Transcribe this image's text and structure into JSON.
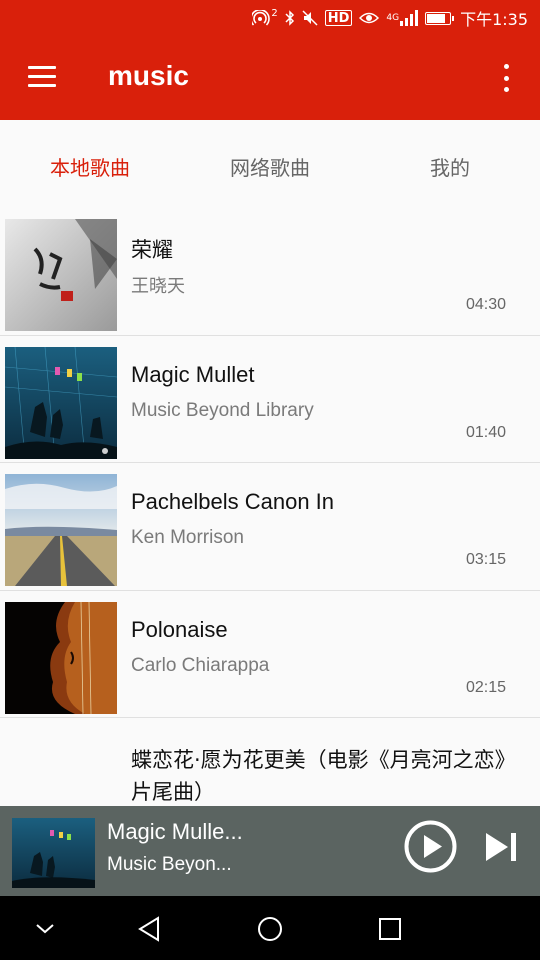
{
  "status_bar": {
    "hotspot_label": "2",
    "network_label": "4G",
    "hd_label": "HD",
    "time": "下午1:35",
    "battery_level": 0.85
  },
  "app_bar": {
    "title": "music",
    "menu_icon": "hamburger-menu-icon",
    "more_icon": "more-vertical-icon"
  },
  "tabs": [
    {
      "label": "本地歌曲",
      "active": true
    },
    {
      "label": "网络歌曲",
      "active": false
    },
    {
      "label": "我的",
      "active": false
    }
  ],
  "songs": [
    {
      "title": "荣耀",
      "artist": "王晓天",
      "duration": "04:30"
    },
    {
      "title": "Magic Mullet",
      "artist": "Music Beyond Library",
      "duration": "01:40"
    },
    {
      "title": "Pachelbels Canon In",
      "artist": "Ken Morrison",
      "duration": "03:15"
    },
    {
      "title": "Polonaise",
      "artist": "Carlo Chiarappa",
      "duration": "02:15"
    },
    {
      "title": "蝶恋花·愿为花更美（电影《月亮河之恋》片尾曲）",
      "artist": "",
      "duration": ""
    }
  ],
  "player": {
    "title": "Magic Mulle...",
    "artist": "Music Beyon...",
    "play_icon": "play-circle-icon",
    "next_icon": "skip-next-icon"
  },
  "nav_bar": {
    "icons": [
      "collapse-chevron-icon",
      "back-icon",
      "home-icon",
      "recents-icon"
    ]
  },
  "colors": {
    "accent": "#d9200b",
    "player_bg": "#5b6461",
    "text_primary": "#111111",
    "text_secondary": "#7a7a7a"
  }
}
